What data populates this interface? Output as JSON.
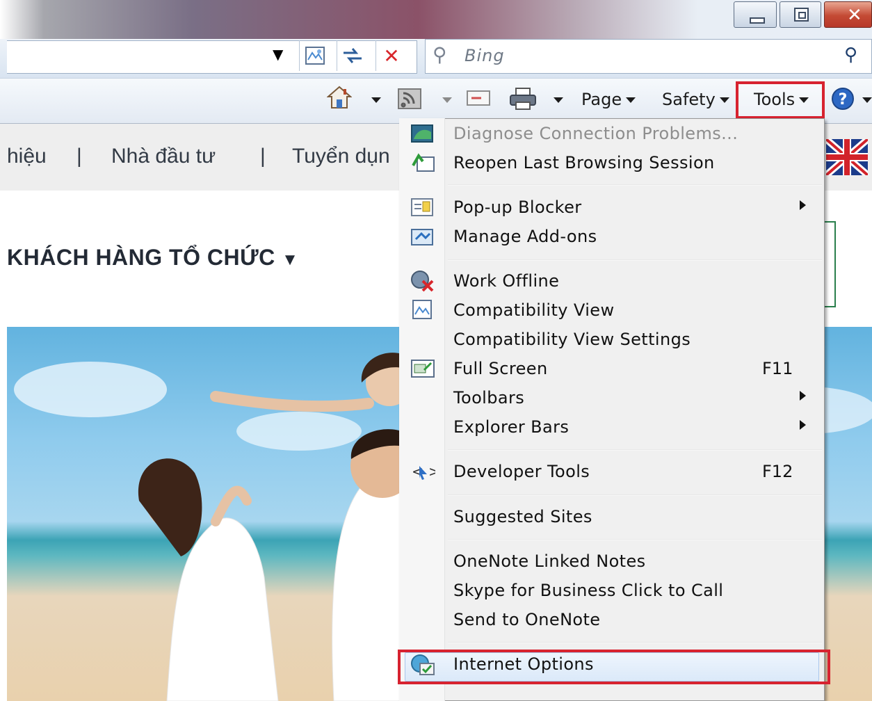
{
  "address_bar": {
    "search_placeholder": "Bing",
    "icons": [
      "compatibility-view-icon",
      "refresh-icon",
      "stop-icon",
      "search-icon"
    ]
  },
  "command_bar": {
    "page_label": "Page",
    "safety_label": "Safety",
    "tools_label": "Tools",
    "icons": [
      "home-icon",
      "feeds-icon",
      "read-mail-icon",
      "print-icon",
      "help-icon"
    ]
  },
  "page": {
    "nav_item_1": "hiệu",
    "nav_sep_1": "|",
    "nav_item_2": "Nhà đầu tư",
    "nav_sep_2": "|",
    "nav_item_3": "Tuyển dụn",
    "section_title": "KHÁCH HÀNG TỔ CHỨC"
  },
  "tools_menu": {
    "items": [
      {
        "label": "Diagnose Connection Problems...",
        "disabled": true,
        "icon": "diagnose-icon"
      },
      {
        "label": "Reopen Last Browsing Session",
        "icon": "reopen-icon"
      },
      {
        "label": "Pop-up Blocker",
        "submenu": true,
        "icon": "popup-blocker-icon"
      },
      {
        "label": "Manage Add-ons",
        "icon": "addons-icon"
      },
      {
        "label": "Work Offline",
        "icon": "work-offline-icon"
      },
      {
        "label": "Compatibility View",
        "icon": "compatibility-view-icon"
      },
      {
        "label": "Compatibility View Settings"
      },
      {
        "label": "Full Screen",
        "shortcut": "F11",
        "icon": "full-screen-icon"
      },
      {
        "label": "Toolbars",
        "submenu": true
      },
      {
        "label": "Explorer Bars",
        "submenu": true
      },
      {
        "label": "Developer Tools",
        "shortcut": "F12",
        "icon": "developer-tools-icon"
      },
      {
        "label": "Suggested Sites"
      },
      {
        "label": "OneNote Linked Notes"
      },
      {
        "label": "Skype for Business Click to Call"
      },
      {
        "label": "Send to OneNote"
      },
      {
        "label": "Internet Options",
        "icon": "internet-options-icon",
        "highlighted": true
      }
    ]
  },
  "colors": {
    "highlight_red": "#d72330",
    "menu_background": "#f0f0f0",
    "disabled_text": "#8d8d8d"
  }
}
